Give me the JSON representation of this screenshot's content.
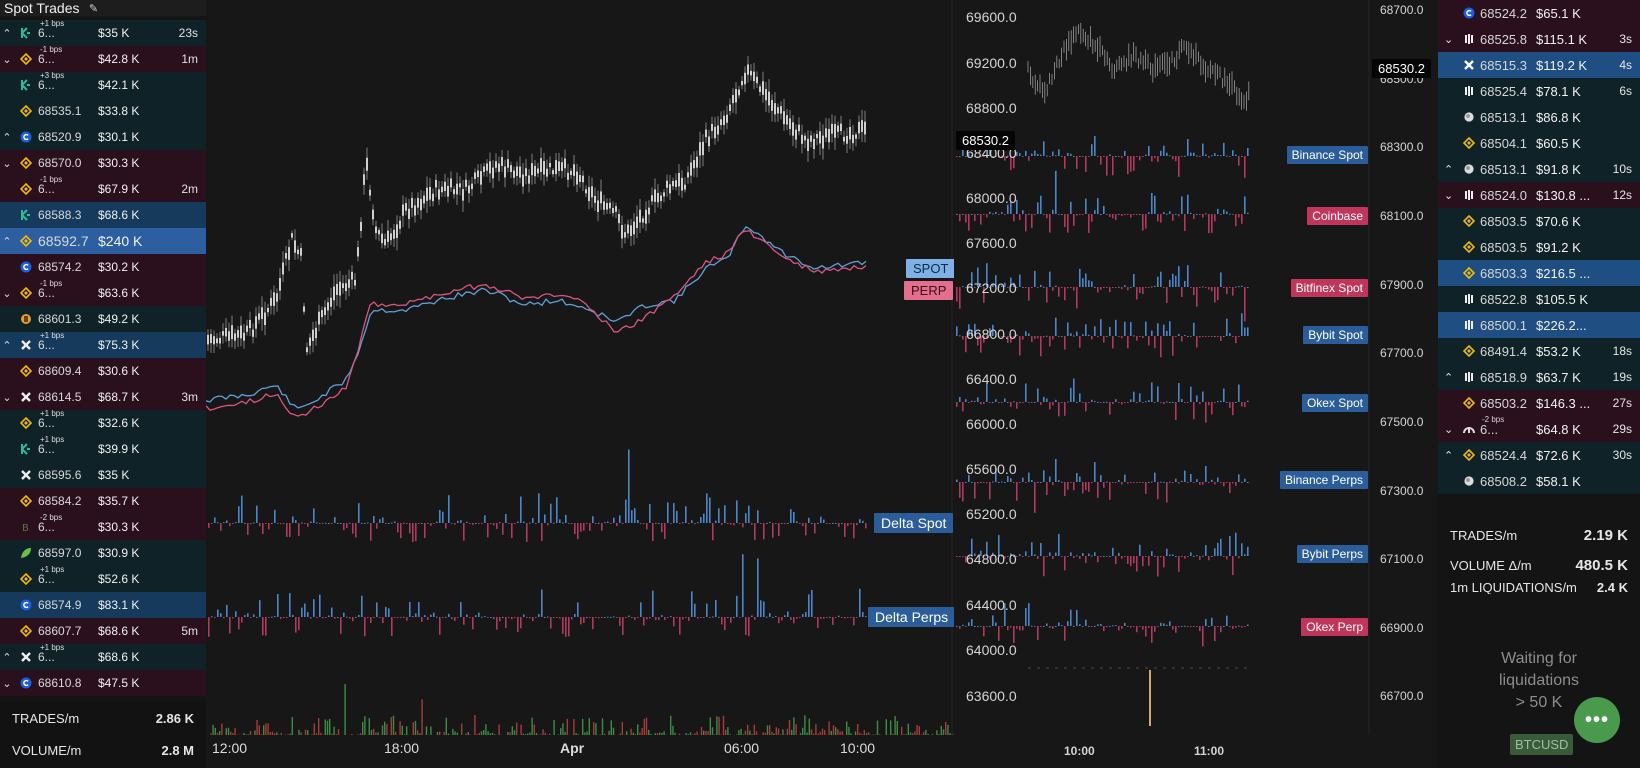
{
  "header": {
    "title": "Spot Trades"
  },
  "left_trades": [
    {
      "dir": "up",
      "ex": "kucoin",
      "price": "6...",
      "bps": "+1 bps",
      "amount": "$35 K",
      "time": "23s",
      "style": "buy"
    },
    {
      "dir": "down",
      "ex": "binance",
      "price": "6...",
      "bps": "-1 bps",
      "amount": "$42.8 K",
      "time": "1m",
      "style": "sell"
    },
    {
      "dir": "",
      "ex": "kucoin",
      "price": "6...",
      "bps": "+3 bps",
      "amount": "$42.1 K",
      "time": "",
      "style": "buy"
    },
    {
      "dir": "",
      "ex": "binance",
      "price": "68535.1",
      "bps": "",
      "amount": "$33.8 K",
      "time": "",
      "style": "buy"
    },
    {
      "dir": "up",
      "ex": "coinbase",
      "price": "68520.9",
      "bps": "",
      "amount": "$30.1 K",
      "time": "",
      "style": "buy"
    },
    {
      "dir": "down",
      "ex": "binance",
      "price": "68570.0",
      "bps": "",
      "amount": "$30.3 K",
      "time": "",
      "style": "sell"
    },
    {
      "dir": "",
      "ex": "binance",
      "price": "6...",
      "bps": "-1 bps",
      "amount": "$67.9 K",
      "time": "2m",
      "style": "sell"
    },
    {
      "dir": "",
      "ex": "kucoin",
      "price": "68588.3",
      "bps": "",
      "amount": "$68.6 K",
      "time": "",
      "style": "hbuy"
    },
    {
      "dir": "up",
      "ex": "binance",
      "price": "68592.7",
      "bps": "",
      "amount": "$240 K",
      "time": "",
      "style": "big"
    },
    {
      "dir": "",
      "ex": "coinbase",
      "price": "68574.2",
      "bps": "",
      "amount": "$30.2 K",
      "time": "",
      "style": "sell"
    },
    {
      "dir": "down",
      "ex": "binance",
      "price": "6...",
      "bps": "-1 bps",
      "amount": "$63.6 K",
      "time": "",
      "style": "sell"
    },
    {
      "dir": "",
      "ex": "bitget",
      "price": "68601.3",
      "bps": "",
      "amount": "$49.2 K",
      "time": "",
      "style": "buy"
    },
    {
      "dir": "up",
      "ex": "okx",
      "price": "6...",
      "bps": "+1 bps",
      "amount": "$75.3 K",
      "time": "",
      "style": "hbuy"
    },
    {
      "dir": "",
      "ex": "binance",
      "price": "68609.4",
      "bps": "",
      "amount": "$30.6 K",
      "time": "",
      "style": "sell"
    },
    {
      "dir": "down",
      "ex": "okx",
      "price": "68614.5",
      "bps": "",
      "amount": "$68.7 K",
      "time": "3m",
      "style": "sell"
    },
    {
      "dir": "",
      "ex": "binance",
      "price": "6...",
      "bps": "+1 bps",
      "amount": "$32.6 K",
      "time": "",
      "style": "buy"
    },
    {
      "dir": "",
      "ex": "kucoin",
      "price": "6...",
      "bps": "+1 bps",
      "amount": "$39.9 K",
      "time": "",
      "style": "buy"
    },
    {
      "dir": "",
      "ex": "okx",
      "price": "68595.6",
      "bps": "",
      "amount": "$35 K",
      "time": "",
      "style": "buy"
    },
    {
      "dir": "",
      "ex": "binance",
      "price": "68584.2",
      "bps": "",
      "amount": "$35.7 K",
      "time": "",
      "style": "sell"
    },
    {
      "dir": "",
      "ex": "bitcoin",
      "price": "6...",
      "bps": "-2 bps",
      "amount": "$30.3 K",
      "time": "",
      "style": "sell"
    },
    {
      "dir": "",
      "ex": "leaf",
      "price": "68597.0",
      "bps": "",
      "amount": "$30.9 K",
      "time": "",
      "style": "buy"
    },
    {
      "dir": "",
      "ex": "binance",
      "price": "6...",
      "bps": "+1 bps",
      "amount": "$52.6 K",
      "time": "",
      "style": "buy"
    },
    {
      "dir": "",
      "ex": "coinbase",
      "price": "68574.9",
      "bps": "",
      "amount": "$83.1 K",
      "time": "",
      "style": "hbuy"
    },
    {
      "dir": "",
      "ex": "binance",
      "price": "68607.7",
      "bps": "",
      "amount": "$68.6 K",
      "time": "5m",
      "style": "sell"
    },
    {
      "dir": "up",
      "ex": "okx",
      "price": "6...",
      "bps": "+1 bps",
      "amount": "$68.6 K",
      "time": "",
      "style": "buy"
    },
    {
      "dir": "down",
      "ex": "coinbase",
      "price": "68610.8",
      "bps": "",
      "amount": "$47.5 K",
      "time": "",
      "style": "sell"
    }
  ],
  "left_stats": [
    {
      "label": "TRADES/m",
      "value": "2.86 K"
    },
    {
      "label": "VOLUME/m",
      "value": "2.8 M"
    }
  ],
  "main_chart": {
    "x_labels": [
      "12:00",
      "18:00",
      "Apr",
      "06:00",
      "10:00"
    ],
    "spot_label": "SPOT",
    "perp_label": "PERP",
    "delta_spot_label": "Delta Spot",
    "delta_perps_label": "Delta Perps"
  },
  "mid_chart": {
    "y_labels": [
      "69600.0",
      "69200.0",
      "68800.0",
      "68400.0",
      "68000.0",
      "67600.0",
      "67200.0",
      "66800.0",
      "66400.0",
      "66000.0",
      "65600.0",
      "65200.0",
      "64800.0",
      "64400.0",
      "64000.0",
      "63600.0"
    ],
    "price_tag_left": "68530.2",
    "x_labels": [
      "10:00",
      "11:00"
    ],
    "exchange_labels": [
      {
        "text": "Binance Spot",
        "color": "blue"
      },
      {
        "text": "Coinbase",
        "color": "red"
      },
      {
        "text": "Bitfinex Spot",
        "color": "red"
      },
      {
        "text": "Bybit Spot",
        "color": "blue"
      },
      {
        "text": "Okex Spot",
        "color": "blue"
      },
      {
        "text": "Binance Perps",
        "color": "blue"
      },
      {
        "text": "Bybit Perps",
        "color": "blue"
      },
      {
        "text": "Okex Perp",
        "color": "red"
      }
    ],
    "right_axis": [
      "68700.0",
      "68500.0",
      "68300.0",
      "68100.0",
      "67900.0",
      "67700.0",
      "67500.0",
      "67300.0",
      "67100.0",
      "66900.0",
      "66700.0"
    ],
    "price_tag_right": "68530.2"
  },
  "right_trades": [
    {
      "dir": "",
      "ex": "coinbase",
      "price": "68524.2",
      "bps": "",
      "amount": "$65.1 K",
      "time": "",
      "style": "sell"
    },
    {
      "dir": "down",
      "ex": "bitfinex",
      "price": "68525.8",
      "bps": "",
      "amount": "$115.1 K",
      "time": "3s",
      "style": "sell"
    },
    {
      "dir": "",
      "ex": "x",
      "price": "68515.3",
      "bps": "",
      "amount": "$119.2 K",
      "time": "4s",
      "style": "hbuy"
    },
    {
      "dir": "",
      "ex": "bitfinex",
      "price": "68525.4",
      "bps": "",
      "amount": "$78.1 K",
      "time": "6s",
      "style": "buy"
    },
    {
      "dir": "",
      "ex": "coin",
      "price": "68513.1",
      "bps": "",
      "amount": "$86.8 K",
      "time": "",
      "style": "buy"
    },
    {
      "dir": "",
      "ex": "binance",
      "price": "68504.1",
      "bps": "",
      "amount": "$60.5 K",
      "time": "",
      "style": "buy"
    },
    {
      "dir": "up",
      "ex": "coin",
      "price": "68513.1",
      "bps": "",
      "amount": "$91.8 K",
      "time": "10s",
      "style": "buy"
    },
    {
      "dir": "down",
      "ex": "bitfinex",
      "price": "68524.0",
      "bps": "",
      "amount": "$130.8 ...",
      "time": "12s",
      "style": "sell"
    },
    {
      "dir": "",
      "ex": "binance",
      "price": "68503.5",
      "bps": "",
      "amount": "$70.6 K",
      "time": "",
      "style": "buy"
    },
    {
      "dir": "",
      "ex": "binance",
      "price": "68503.5",
      "bps": "",
      "amount": "$91.2 K",
      "time": "",
      "style": "buy"
    },
    {
      "dir": "",
      "ex": "binance",
      "price": "68503.3",
      "bps": "",
      "amount": "$216.5 ...",
      "time": "",
      "style": "hbuy"
    },
    {
      "dir": "",
      "ex": "bitfinex",
      "price": "68522.8",
      "bps": "",
      "amount": "$105.5 K",
      "time": "",
      "style": "buy"
    },
    {
      "dir": "",
      "ex": "bitfinex",
      "price": "68500.1",
      "bps": "",
      "amount": "$226.2...",
      "time": "",
      "style": "hbuy"
    },
    {
      "dir": "",
      "ex": "binance",
      "price": "68491.4",
      "bps": "",
      "amount": "$53.2 K",
      "time": "18s",
      "style": "buy"
    },
    {
      "dir": "up",
      "ex": "bitfinex",
      "price": "68518.9",
      "bps": "",
      "amount": "$63.7 K",
      "time": "19s",
      "style": "buy"
    },
    {
      "dir": "",
      "ex": "binance",
      "price": "68503.2",
      "bps": "",
      "amount": "$146.3 ...",
      "time": "27s",
      "style": "sell"
    },
    {
      "dir": "down",
      "ex": "huobi",
      "price": "6...",
      "bps": "-2 bps",
      "amount": "$64.8 K",
      "time": "29s",
      "style": "sell"
    },
    {
      "dir": "up",
      "ex": "binance",
      "price": "68524.4",
      "bps": "",
      "amount": "$72.6 K",
      "time": "30s",
      "style": "buy"
    },
    {
      "dir": "",
      "ex": "coin",
      "price": "68508.2",
      "bps": "",
      "amount": "$58.1 K",
      "time": "",
      "style": "buy"
    }
  ],
  "right_stats": [
    {
      "label": "TRADES/m",
      "value": "2.19 K"
    },
    {
      "label": "VOLUME Δ/m",
      "value": "480.5 K"
    },
    {
      "label": "1m LIQUIDATIONS/m",
      "value": "2.4 K"
    }
  ],
  "waiting": {
    "line1": "Waiting for",
    "line2": "liquidations",
    "line3": "> 50 K"
  },
  "ticker": "BTCUSD",
  "fab": "•••"
}
